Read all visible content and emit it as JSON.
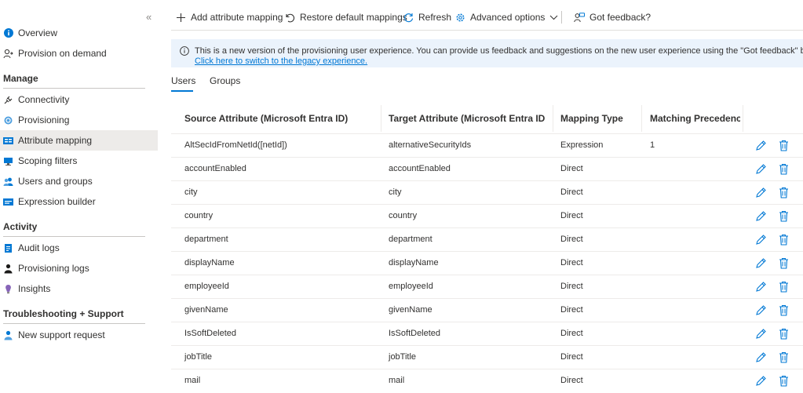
{
  "sidebar": {
    "collapse_glyph": "«",
    "items_top": [
      {
        "label": "Overview",
        "icon": "info-icon"
      },
      {
        "label": "Provision on demand",
        "icon": "person-sync-icon"
      }
    ],
    "sections": [
      {
        "title": "Manage",
        "items": [
          {
            "label": "Connectivity",
            "icon": "plug-icon"
          },
          {
            "label": "Provisioning",
            "icon": "cloud-sync-icon"
          },
          {
            "label": "Attribute mapping",
            "icon": "mapping-icon",
            "selected": true
          },
          {
            "label": "Scoping filters",
            "icon": "filter-monitor-icon"
          },
          {
            "label": "Users and groups",
            "icon": "users-icon"
          },
          {
            "label": "Expression builder",
            "icon": "expression-icon"
          }
        ]
      },
      {
        "title": "Activity",
        "items": [
          {
            "label": "Audit logs",
            "icon": "audit-log-icon"
          },
          {
            "label": "Provisioning logs",
            "icon": "person-log-icon"
          },
          {
            "label": "Insights",
            "icon": "lightbulb-icon"
          }
        ]
      },
      {
        "title": "Troubleshooting + Support",
        "items": [
          {
            "label": "New support request",
            "icon": "support-person-icon"
          }
        ]
      }
    ]
  },
  "toolbar": {
    "add_label": "Add attribute mapping",
    "restore_label": "Restore default mappings",
    "refresh_label": "Refresh",
    "advanced_label": "Advanced options",
    "feedback_label": "Got feedback?"
  },
  "banner": {
    "text": "This is a new version of the provisioning user experience. You can provide us feedback and suggestions on the new user experience using the \"Got feedback\" button.",
    "link": "Click here to switch to the legacy experience."
  },
  "tabs": [
    {
      "label": "Users",
      "active": true
    },
    {
      "label": "Groups",
      "active": false
    }
  ],
  "table": {
    "headers": [
      "Source Attribute (Microsoft Entra ID)",
      "Target Attribute (Microsoft Entra ID (tar...",
      "Mapping Type",
      "Matching Precedence"
    ],
    "rows": [
      {
        "source": "AltSecIdFromNetId([netId])",
        "target": "alternativeSecurityIds",
        "type": "Expression",
        "precedence": "1"
      },
      {
        "source": "accountEnabled",
        "target": "accountEnabled",
        "type": "Direct",
        "precedence": ""
      },
      {
        "source": "city",
        "target": "city",
        "type": "Direct",
        "precedence": ""
      },
      {
        "source": "country",
        "target": "country",
        "type": "Direct",
        "precedence": ""
      },
      {
        "source": "department",
        "target": "department",
        "type": "Direct",
        "precedence": ""
      },
      {
        "source": "displayName",
        "target": "displayName",
        "type": "Direct",
        "precedence": ""
      },
      {
        "source": "employeeId",
        "target": "employeeId",
        "type": "Direct",
        "precedence": ""
      },
      {
        "source": "givenName",
        "target": "givenName",
        "type": "Direct",
        "precedence": ""
      },
      {
        "source": "IsSoftDeleted",
        "target": "IsSoftDeleted",
        "type": "Direct",
        "precedence": ""
      },
      {
        "source": "jobTitle",
        "target": "jobTitle",
        "type": "Direct",
        "precedence": ""
      },
      {
        "source": "mail",
        "target": "mail",
        "type": "Direct",
        "precedence": ""
      }
    ]
  },
  "colors": {
    "accent": "#0078d4",
    "selected_bg": "#edebe9",
    "banner_bg": "#ebf3fc",
    "delete": "#0078d4"
  }
}
